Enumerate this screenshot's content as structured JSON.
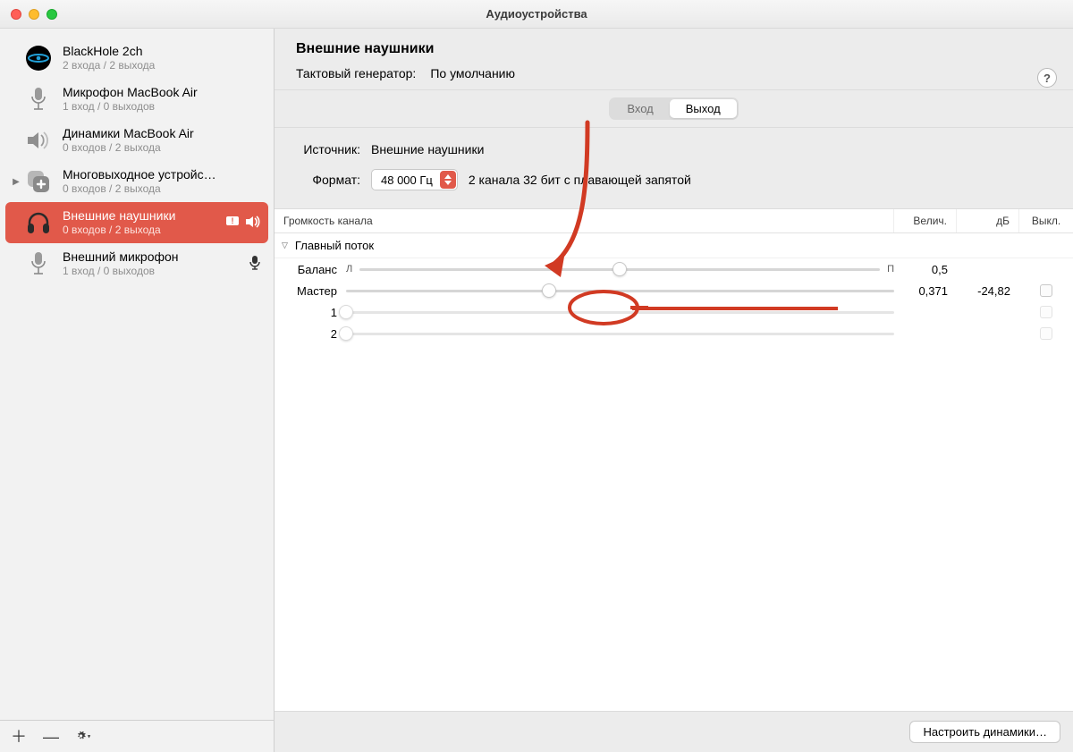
{
  "window": {
    "title": "Аудиоустройства"
  },
  "sidebar": {
    "devices": [
      {
        "id": "blackhole",
        "name": "BlackHole 2ch",
        "sub": "2 входа / 2 выхода"
      },
      {
        "id": "mic-mba",
        "name": "Микрофон MacBook Air",
        "sub": "1 вход / 0 выходов"
      },
      {
        "id": "spk-mba",
        "name": "Динамики MacBook Air",
        "sub": "0 входов / 2 выхода"
      },
      {
        "id": "multi",
        "name": "Многовыходное устройс…",
        "sub": "0 входов / 2 выхода"
      },
      {
        "id": "headphones",
        "name": "Внешние наушники",
        "sub": "0 входов / 2 выхода"
      },
      {
        "id": "ext-mic",
        "name": "Внешний микрофон",
        "sub": "1 вход / 0 выходов"
      }
    ]
  },
  "main": {
    "device_title": "Внешние наушники",
    "clock_label": "Тактовый генератор:",
    "clock_value": "По умолчанию",
    "tabs": {
      "input": "Вход",
      "output": "Выход"
    },
    "source_label": "Источник:",
    "source_value": "Внешние наушники",
    "format_label": "Формат:",
    "format_rate": "48 000 Гц",
    "format_desc": "2 канала 32 бит с плавающей запятой",
    "columns": {
      "name": "Громкость канала",
      "value": "Велич.",
      "db": "дБ",
      "mute": "Выкл."
    },
    "group": "Главный поток",
    "balance": {
      "label": "Баланс",
      "left": "Л",
      "right": "П",
      "value": "0,5",
      "position": 0.5
    },
    "master": {
      "label": "Мастер",
      "value": "0,371",
      "db": "-24,82",
      "position": 0.371
    },
    "ch1": {
      "label": "1"
    },
    "ch2": {
      "label": "2"
    },
    "footer_button": "Настроить динамики…"
  }
}
